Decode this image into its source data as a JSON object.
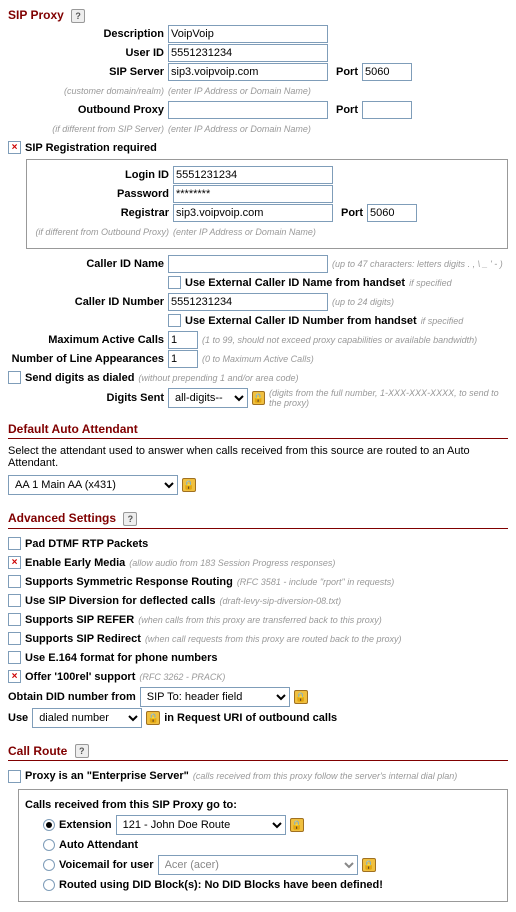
{
  "sip_proxy": {
    "title": "SIP Proxy",
    "description_label": "Description",
    "description_value": "VoipVoip",
    "user_id_label": "User ID",
    "user_id_value": "5551231234",
    "sip_server_label": "SIP Server",
    "sip_server_value": "sip3.voipvoip.com",
    "sip_server_port": "5060",
    "sip_server_hint_left": "(customer domain/realm)",
    "sip_server_hint_right": "(enter IP Address or Domain Name)",
    "outbound_proxy_label": "Outbound Proxy",
    "outbound_proxy_value": "",
    "outbound_proxy_port": "",
    "outbound_hint_left": "(if different from SIP Server)",
    "outbound_hint_right": "(enter IP Address or Domain Name)",
    "port_label": "Port",
    "reg_required_label": "SIP Registration required",
    "login_id_label": "Login ID",
    "login_id_value": "5551231234",
    "password_label": "Password",
    "password_value": "********",
    "registrar_label": "Registrar",
    "registrar_value": "sip3.voipvoip.com",
    "registrar_port": "5060",
    "registrar_hint_left": "(if different from Outbound Proxy)",
    "registrar_hint_right": "(enter IP Address or Domain Name)",
    "caller_id_name_label": "Caller ID Name",
    "caller_id_name_value": "",
    "caller_id_name_hint": "(up to 47 characters: letters digits . , \\ _ ' - )",
    "use_ext_cid_name": "Use External Caller ID Name from handset",
    "if_specified": "if specified",
    "caller_id_number_label": "Caller ID Number",
    "caller_id_number_value": "5551231234",
    "caller_id_number_hint": "(up to 24 digits)",
    "use_ext_cid_number": "Use External Caller ID Number from handset",
    "max_active_calls_label": "Maximum Active Calls",
    "max_active_calls_value": "1",
    "max_active_calls_hint": "(1 to 99, should not exceed proxy capabilities or available bandwidth)",
    "num_line_app_label": "Number of Line Appearances",
    "num_line_app_value": "1",
    "num_line_app_hint": "(0 to Maximum Active Calls)",
    "send_digits_label": "Send digits as dialed",
    "send_digits_hint": "(without prepending 1 and/or area code)",
    "digits_sent_label": "Digits Sent",
    "digits_sent_value": "all-digits--",
    "digits_sent_hint": "(digits from the full number, 1-XXX-XXX-XXXX, to send to the proxy)"
  },
  "auto_attendant": {
    "title": "Default Auto Attendant",
    "desc": "Select the attendant used to answer when calls received from this source are routed to an Auto Attendant.",
    "value": "AA 1 Main AA (x431)"
  },
  "advanced": {
    "title": "Advanced Settings",
    "pad_dtmf": "Pad DTMF RTP Packets",
    "early_media": "Enable Early Media",
    "early_media_hint": "(allow audio from 183 Session Progress responses)",
    "sym_resp": "Supports Symmetric Response Routing",
    "sym_resp_hint": "(RFC 3581 - include \"rport\" in requests)",
    "sip_diversion": "Use SIP Diversion for deflected calls",
    "sip_diversion_hint": "(draft-levy-sip-diversion-08.txt)",
    "sip_refer": "Supports SIP REFER",
    "sip_refer_hint": "(when calls from this proxy are transferred back to this proxy)",
    "sip_redirect": "Supports SIP Redirect",
    "sip_redirect_hint": "(when call requests from this proxy are routed back to the proxy)",
    "e164": "Use E.164 format for phone numbers",
    "offer_100rel": "Offer '100rel' support",
    "offer_100rel_hint": "(RFC 3262 - PRACK)",
    "obtain_did_label": "Obtain DID number from",
    "obtain_did_value": "SIP To: header field",
    "use_label_pre": "Use",
    "use_value": "dialed number",
    "use_label_post": "in Request URI of outbound calls"
  },
  "call_route": {
    "title": "Call Route",
    "enterprise_label": "Proxy is an \"Enterprise Server\"",
    "enterprise_hint": "(calls received from this proxy follow the server's internal dial plan)",
    "go_to_label": "Calls received from this SIP Proxy go to:",
    "extension_label": "Extension",
    "extension_value": "121 - John Doe Route",
    "auto_attendant_label": "Auto Attendant",
    "voicemail_label": "Voicemail for user",
    "voicemail_value": "Acer (acer)",
    "did_label": "Routed using DID Block(s): No DID Blocks have been defined!"
  }
}
